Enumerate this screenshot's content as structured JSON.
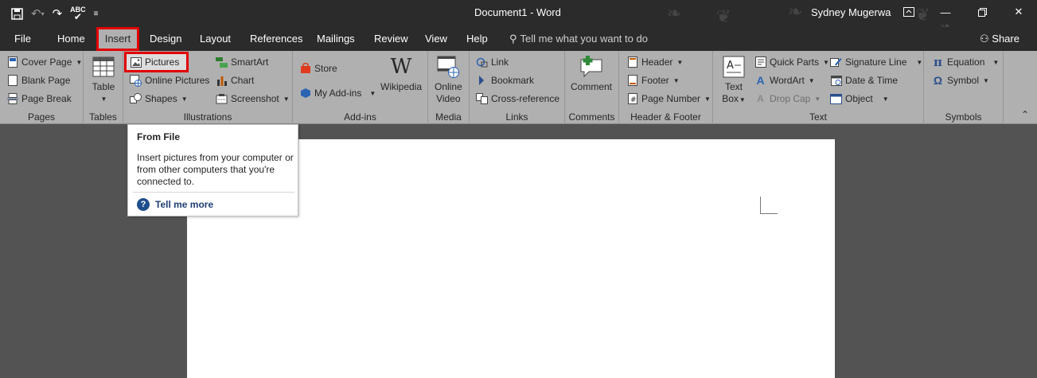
{
  "window": {
    "doc_title": "Document1  -  Word",
    "user": "Sydney Mugerwa",
    "qat_icons": [
      "save-icon",
      "undo-icon",
      "redo-icon",
      "spelling-check-icon",
      "customize-qat-icon"
    ]
  },
  "tabs": [
    "File",
    "Home",
    "Insert",
    "Design",
    "Layout",
    "References",
    "Mailings",
    "Review",
    "View",
    "Help"
  ],
  "active_tab": "Insert",
  "tell_me": "Tell me what you want to do",
  "share": "Share",
  "ribbon": {
    "pages": {
      "label": "Pages",
      "cover_page": "Cover Page",
      "blank_page": "Blank Page",
      "page_break": "Page Break"
    },
    "tables": {
      "label": "Tables",
      "table": "Table"
    },
    "illustrations": {
      "label": "Illustrations",
      "pictures": "Pictures",
      "online_pictures": "Online Pictures",
      "shapes": "Shapes",
      "smartart": "SmartArt",
      "chart": "Chart",
      "screenshot": "Screenshot"
    },
    "addins": {
      "label": "Add-ins",
      "store": "Store",
      "my_addins": "My Add-ins",
      "wikipedia": "Wikipedia"
    },
    "media": {
      "label": "Media",
      "online_video_1": "Online",
      "online_video_2": "Video"
    },
    "links": {
      "label": "Links",
      "link": "Link",
      "bookmark": "Bookmark",
      "cross_reference": "Cross-reference"
    },
    "comments": {
      "label": "Comments",
      "comment": "Comment"
    },
    "header_footer": {
      "label": "Header & Footer",
      "header": "Header",
      "footer": "Footer",
      "page_number": "Page Number"
    },
    "text": {
      "label": "Text",
      "text_box_1": "Text",
      "text_box_2": "Box",
      "quick_parts": "Quick Parts",
      "wordart": "WordArt",
      "drop_cap": "Drop Cap",
      "signature_line": "Signature Line",
      "date_time": "Date & Time",
      "object": "Object"
    },
    "symbols": {
      "label": "Symbols",
      "equation": "Equation",
      "symbol": "Symbol"
    }
  },
  "tooltip": {
    "title": "From File",
    "body": "Insert pictures from your computer or from other computers that you're connected to.",
    "more": "Tell me more"
  }
}
